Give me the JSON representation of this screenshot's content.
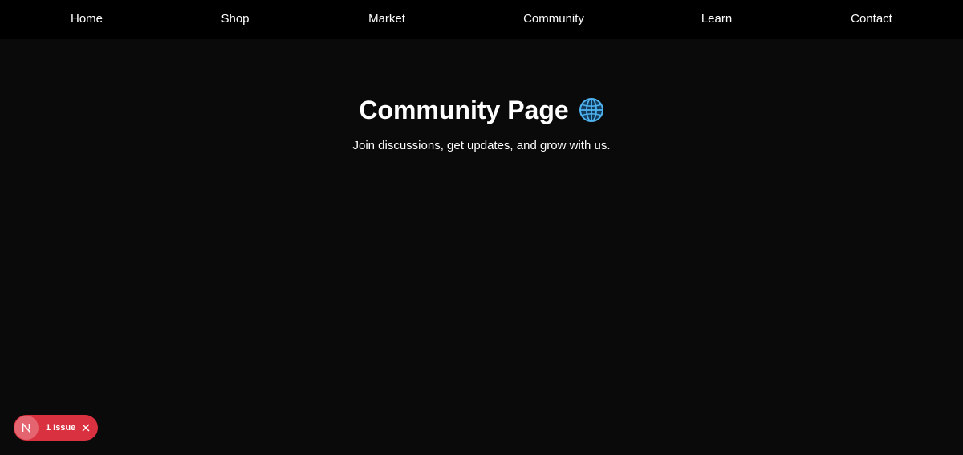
{
  "nav": {
    "items": [
      {
        "label": "Home"
      },
      {
        "label": "Shop"
      },
      {
        "label": "Market"
      },
      {
        "label": "Community"
      },
      {
        "label": "Learn"
      },
      {
        "label": "Contact"
      }
    ]
  },
  "hero": {
    "title": "Community Page",
    "title_icon": "globe-icon",
    "subtitle": "Join discussions, get updates, and grow with us."
  },
  "dev_overlay": {
    "logo_icon": "nextjs-logo-icon",
    "issue_label": "1 Issue",
    "close_icon": "close-icon",
    "badge_color": "#d9313f"
  },
  "colors": {
    "nav_background": "#000000",
    "page_background": "#0a0a0a",
    "text": "#ffffff",
    "globe_accent": "#4fb3f0"
  }
}
